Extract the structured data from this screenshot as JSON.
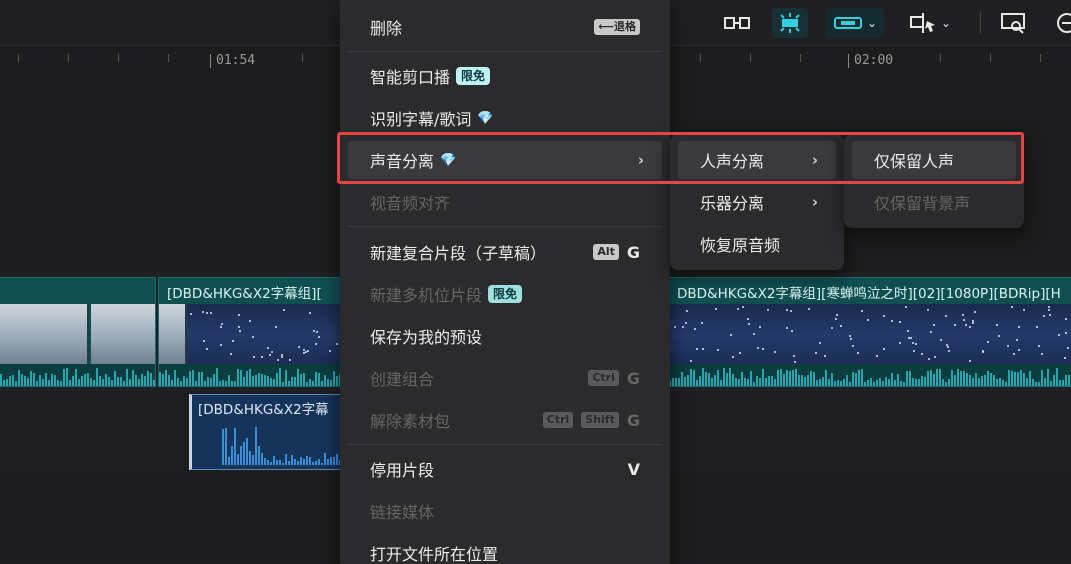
{
  "toolbar": {
    "icons": [
      "split-icon",
      "snap-icon",
      "link-icon",
      "chevron-down-icon",
      "crop-icon",
      "chevron-down-icon",
      "preview-icon",
      "zoom-icon"
    ]
  },
  "ruler": {
    "labels": [
      "01:54",
      "02:00"
    ]
  },
  "tracks": {
    "video_clip_title_1": "[DBD&HKG&X2字幕组][",
    "video_clip_title_2": "DBD&HKG&X2字幕组][寒蝉鸣泣之时][02][1080P][BDRip][H",
    "audio_clip_title": "[DBD&HKG&X2字幕"
  },
  "context_menu": {
    "items": [
      {
        "label": "删除",
        "shortcut": "⟵退格"
      },
      {
        "label": "智能剪口播",
        "badge": "限免"
      },
      {
        "label": "识别字幕/歌词",
        "icon": "gem-icon"
      },
      {
        "label": "声音分离",
        "icon": "gem-icon",
        "submenu": true
      },
      {
        "label": "视音频对齐",
        "disabled": true
      },
      {
        "label": "新建复合片段（子草稿）",
        "kbd": "Alt",
        "key": "G"
      },
      {
        "label": "新建多机位片段",
        "badge": "限免",
        "disabled": true
      },
      {
        "label": "保存为我的预设"
      },
      {
        "label": "创建组合",
        "kbd": "Ctrl",
        "key": "G",
        "disabled": true
      },
      {
        "label": "解除素材包",
        "kbd": "Ctrl",
        "kbd2": "Shift",
        "key": "G",
        "disabled": true
      },
      {
        "label": "停用片段",
        "key": "V"
      },
      {
        "label": "链接媒体",
        "disabled": true
      },
      {
        "label": "打开文件所在位置"
      }
    ]
  },
  "submenu_1": {
    "items": [
      {
        "label": "人声分离"
      },
      {
        "label": "乐器分离"
      },
      {
        "label": "恢复原音频"
      }
    ]
  },
  "submenu_2": {
    "items": [
      {
        "label": "仅保留人声"
      },
      {
        "label": "仅保留背景声",
        "disabled": true
      }
    ]
  },
  "colors": {
    "highlight": "#e94444",
    "accent": "#2fd0e0",
    "badge": "#bff3f3"
  }
}
